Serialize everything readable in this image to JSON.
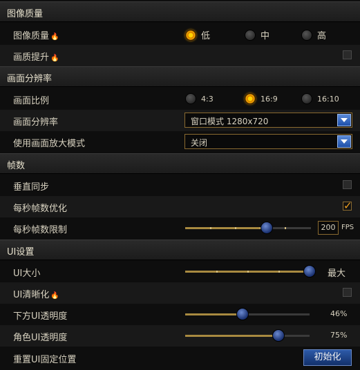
{
  "sections": {
    "image_quality": "图像质量",
    "resolution": "画面分辨率",
    "framerate": "帧数",
    "ui": "UI设置"
  },
  "rows": {
    "quality": {
      "label": "图像质量",
      "options": [
        "低",
        "中",
        "高"
      ],
      "selected": "低"
    },
    "enhance": {
      "label": "画质提升",
      "checked": false
    },
    "aspect": {
      "label": "画面比例",
      "options": [
        "4:3",
        "16:9",
        "16:10"
      ],
      "selected": "16:9"
    },
    "resolution": {
      "label": "画面分辨率",
      "value": "窗口模式 1280x720"
    },
    "upscale": {
      "label": "使用画面放大模式",
      "value": "关闭"
    },
    "vsync": {
      "label": "垂直同步",
      "checked": false
    },
    "fps_opt": {
      "label": "每秒帧数优化",
      "checked": true
    },
    "fps_limit": {
      "label": "每秒帧数限制",
      "value": "200",
      "unit": "FPS",
      "fraction": 0.65
    },
    "ui_size": {
      "label": "UI大小",
      "value": "最大",
      "fraction": 1.0
    },
    "ui_sharp": {
      "label": "UI清晰化",
      "checked": false
    },
    "lower_ui": {
      "label": "下方UI透明度",
      "value": "46%",
      "fraction": 0.46
    },
    "char_ui": {
      "label": "角色UI透明度",
      "value": "75%",
      "fraction": 0.75
    },
    "reset": {
      "label": "重置UI固定位置",
      "button": "初始化"
    }
  },
  "icons": {
    "flame": "flame-icon",
    "dropdown": "chevron-down-icon"
  },
  "colors": {
    "accent": "#f0a020",
    "knob": "#1a3170",
    "border": "#8a6a30"
  }
}
